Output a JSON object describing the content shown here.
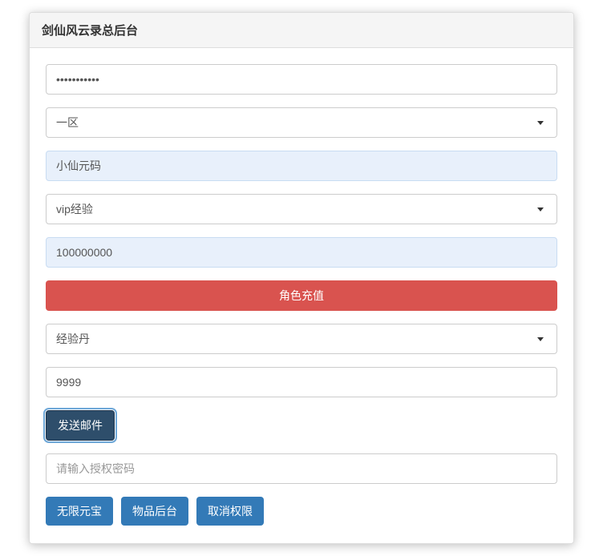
{
  "header": {
    "title": "剑仙风云录总后台"
  },
  "form": {
    "password_value": "•••••••••••",
    "zone_select": "一区",
    "character_name": "小仙元码",
    "recharge_type": "vip经验",
    "recharge_amount": "100000000",
    "recharge_button": "角色充值",
    "item_select": "经验丹",
    "item_quantity": "9999",
    "send_mail_button": "发送邮件",
    "auth_password_placeholder": "请输入授权密码"
  },
  "bottom_buttons": {
    "unlimited_yuanbao": "无限元宝",
    "item_backend": "物品后台",
    "cancel_permission": "取消权限"
  }
}
